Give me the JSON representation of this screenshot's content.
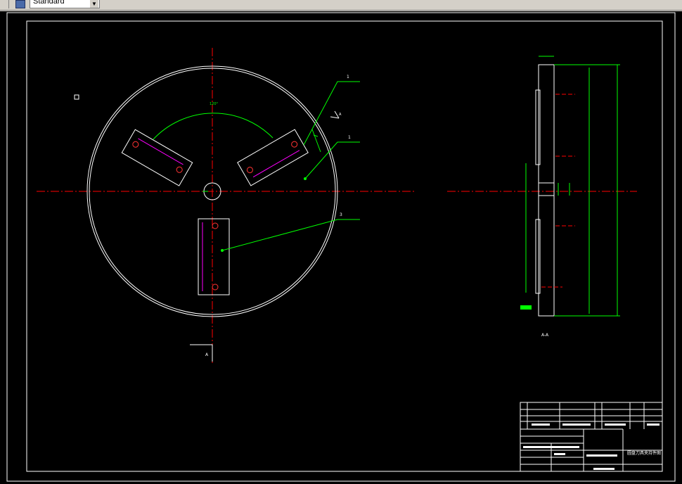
{
  "toolbar": {
    "text_style_value": "Standard",
    "dropdown_arrow": "chevron-down-icon"
  },
  "drawing": {
    "part_labels": [
      "1",
      "1",
      "3"
    ],
    "section_marker_left": "A",
    "section_marker_right": "A",
    "section_view_title": "A-A",
    "title_block": {
      "drawing_name": "圆盘刀具夹持件图"
    }
  },
  "colors": {
    "background": "#000000",
    "red_centerline": "#ff0000",
    "green_dimension": "#00ff00",
    "white_geometry": "#ffffff",
    "magenta_edge": "#ff00ff",
    "toolbar": "#d4d0c8"
  }
}
